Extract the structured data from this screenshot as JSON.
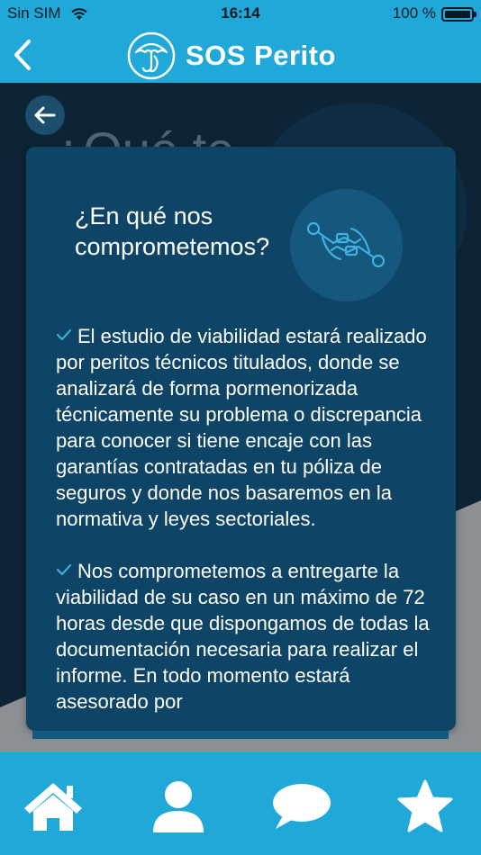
{
  "status_bar": {
    "carrier": "Sin SIM",
    "time": "16:14",
    "battery": "100 %",
    "icons": [
      "wifi-icon",
      "battery-icon"
    ]
  },
  "nav": {
    "title": "SOS Perito",
    "back_icon": "chevron-left-icon",
    "logo_icon": "umbrella-logo-icon"
  },
  "background": {
    "title_fragment": "¿Qué te",
    "back_icon": "arrow-left-icon"
  },
  "card": {
    "heading": "¿En qué nos comprometemos?",
    "illustration": "handshake-icon",
    "paragraphs": [
      "El estudio de viabilidad estará realizado por peritos técnicos titulados, donde se analizará de forma pormenorizada técnicamente su problema o discrepancia para conocer si tiene encaje con las garantías contratadas en tu póliza de seguros y donde nos basaremos en la normativa y leyes sectoriales.",
      "Nos comprometemos a entregarte la viabilidad de su caso en un máximo de 72 horas desde que dispongamos de todas la documentación necesaria para realizar el informe. En todo momento estará asesorado por"
    ]
  },
  "tab_bar": {
    "items": [
      {
        "icon": "home-icon"
      },
      {
        "icon": "user-icon"
      },
      {
        "icon": "chat-icon"
      },
      {
        "icon": "star-icon"
      }
    ]
  },
  "colors": {
    "brand": "#1fa8d8",
    "card": "#0e4466",
    "background": "#0d2436",
    "accent_check": "#37b8e6"
  }
}
